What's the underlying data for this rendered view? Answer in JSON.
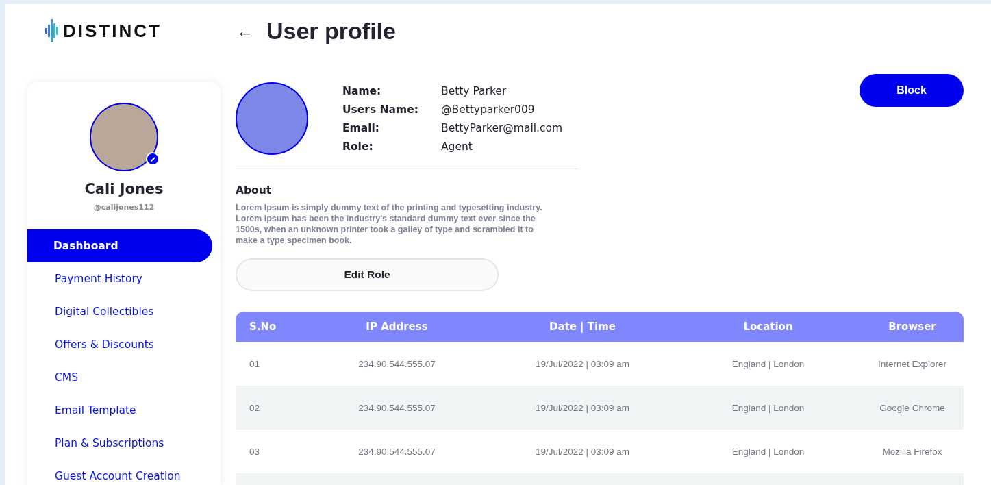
{
  "brand": {
    "name": "DISTINCT"
  },
  "header": {
    "back": "←",
    "title": "User profile"
  },
  "sidebar": {
    "user": {
      "name": "Cali Jones",
      "handle": "@calijones112"
    },
    "items": [
      {
        "label": "Dashboard",
        "selected": true
      },
      {
        "label": "Payment History",
        "selected": false
      },
      {
        "label": "Digital Collectibles",
        "selected": false
      },
      {
        "label": "Offers & Discounts",
        "selected": false
      },
      {
        "label": "CMS",
        "selected": false
      },
      {
        "label": "Email Template",
        "selected": false
      },
      {
        "label": "Plan & Subscriptions",
        "selected": false
      },
      {
        "label": "Guest Account Creation",
        "selected": false
      }
    ]
  },
  "profile": {
    "fields": [
      {
        "label": "Name:",
        "value": "Betty Parker"
      },
      {
        "label": "Users Name:",
        "value": "@Bettyparker009"
      },
      {
        "label": "Email:",
        "value": "BettyParker@mail.com"
      },
      {
        "label": "Role:",
        "value": "Agent"
      }
    ],
    "block_button": "Block",
    "about_title": "About",
    "about_text": "Lorem Ipsum is simply dummy text of the printing and typesetting industry. Lorem Ipsum has been the industry's standard dummy text ever since the 1500s, when an unknown printer took a galley of type and scrambled it to make a type specimen book.",
    "edit_button": "Edit Role"
  },
  "table": {
    "columns": [
      "S.No",
      "IP Address",
      "Date | Time",
      "Location",
      "Browser"
    ],
    "rows": [
      [
        "01",
        "234.90.544.555.07",
        "19/Jul/2022 | 03:09 am",
        "England | London",
        "Internet Explorer"
      ],
      [
        "02",
        "234.90.544.555.07",
        "19/Jul/2022 | 03:09 am",
        "England | London",
        "Google Chrome"
      ],
      [
        "03",
        "234.90.544.555.07",
        "19/Jul/2022 | 03:09 am",
        "England | London",
        "Mozilla Firefox"
      ]
    ]
  }
}
